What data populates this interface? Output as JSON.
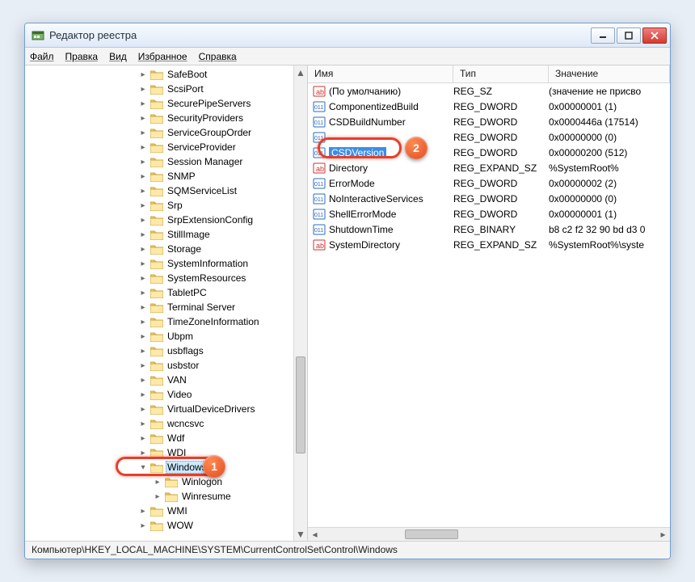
{
  "window": {
    "title": "Редактор реестра"
  },
  "menu": {
    "file": "Файл",
    "edit": "Правка",
    "view": "Вид",
    "favorites": "Избранное",
    "help": "Справка"
  },
  "columns": {
    "name": "Имя",
    "type": "Тип",
    "value": "Значение"
  },
  "statusbar": "Компьютер\\HKEY_LOCAL_MACHINE\\SYSTEM\\CurrentControlSet\\Control\\Windows",
  "tree": [
    {
      "label": "SafeBoot",
      "lvl": 1
    },
    {
      "label": "ScsiPort",
      "lvl": 1
    },
    {
      "label": "SecurePipeServers",
      "lvl": 1
    },
    {
      "label": "SecurityProviders",
      "lvl": 1
    },
    {
      "label": "ServiceGroupOrder",
      "lvl": 1
    },
    {
      "label": "ServiceProvider",
      "lvl": 1
    },
    {
      "label": "Session Manager",
      "lvl": 1
    },
    {
      "label": "SNMP",
      "lvl": 1
    },
    {
      "label": "SQMServiceList",
      "lvl": 1
    },
    {
      "label": "Srp",
      "lvl": 1
    },
    {
      "label": "SrpExtensionConfig",
      "lvl": 1
    },
    {
      "label": "StillImage",
      "lvl": 1
    },
    {
      "label": "Storage",
      "lvl": 1
    },
    {
      "label": "SystemInformation",
      "lvl": 1
    },
    {
      "label": "SystemResources",
      "lvl": 1
    },
    {
      "label": "TabletPC",
      "lvl": 1
    },
    {
      "label": "Terminal Server",
      "lvl": 1
    },
    {
      "label": "TimeZoneInformation",
      "lvl": 1
    },
    {
      "label": "Ubpm",
      "lvl": 1
    },
    {
      "label": "usbflags",
      "lvl": 1
    },
    {
      "label": "usbstor",
      "lvl": 1
    },
    {
      "label": "VAN",
      "lvl": 1
    },
    {
      "label": "Video",
      "lvl": 1
    },
    {
      "label": "VirtualDeviceDrivers",
      "lvl": 1
    },
    {
      "label": "wcncsvc",
      "lvl": 1
    },
    {
      "label": "Wdf",
      "lvl": 1
    },
    {
      "label": "WDI",
      "lvl": 1
    },
    {
      "label": "Windows",
      "lvl": 1,
      "selected": true,
      "expanded": true
    },
    {
      "label": "Winlogon",
      "lvl": 2
    },
    {
      "label": "Winresume",
      "lvl": 2
    },
    {
      "label": "WMI",
      "lvl": 1
    },
    {
      "label": "WOW",
      "lvl": 1
    }
  ],
  "values": [
    {
      "icon": "sz",
      "name": "(По умолчанию)",
      "type": "REG_SZ",
      "value": "(значение не присво"
    },
    {
      "icon": "dw",
      "name": "ComponentizedBuild",
      "type": "REG_DWORD",
      "value": "0x00000001 (1)"
    },
    {
      "icon": "dw",
      "name": "CSDBuildNumber",
      "type": "REG_DWORD",
      "value": "0x0000446a (17514)"
    },
    {
      "icon": "dw",
      "name": "",
      "type": "REG_DWORD",
      "value": "0x00000000 (0)"
    },
    {
      "icon": "dw",
      "name": "CSDVersion",
      "type": "REG_DWORD",
      "value": "0x00000200 (512)",
      "selected": true
    },
    {
      "icon": "sz",
      "name": "Directory",
      "type": "REG_EXPAND_SZ",
      "value": "%SystemRoot%"
    },
    {
      "icon": "dw",
      "name": "ErrorMode",
      "type": "REG_DWORD",
      "value": "0x00000002 (2)"
    },
    {
      "icon": "dw",
      "name": "NoInteractiveServices",
      "type": "REG_DWORD",
      "value": "0x00000000 (0)"
    },
    {
      "icon": "dw",
      "name": "ShellErrorMode",
      "type": "REG_DWORD",
      "value": "0x00000001 (1)"
    },
    {
      "icon": "bn",
      "name": "ShutdownTime",
      "type": "REG_BINARY",
      "value": "b8 c2 f2 32 90 bd d3 0"
    },
    {
      "icon": "sz",
      "name": "SystemDirectory",
      "type": "REG_EXPAND_SZ",
      "value": "%SystemRoot%\\syste"
    }
  ],
  "callouts": {
    "1": "1",
    "2": "2"
  }
}
